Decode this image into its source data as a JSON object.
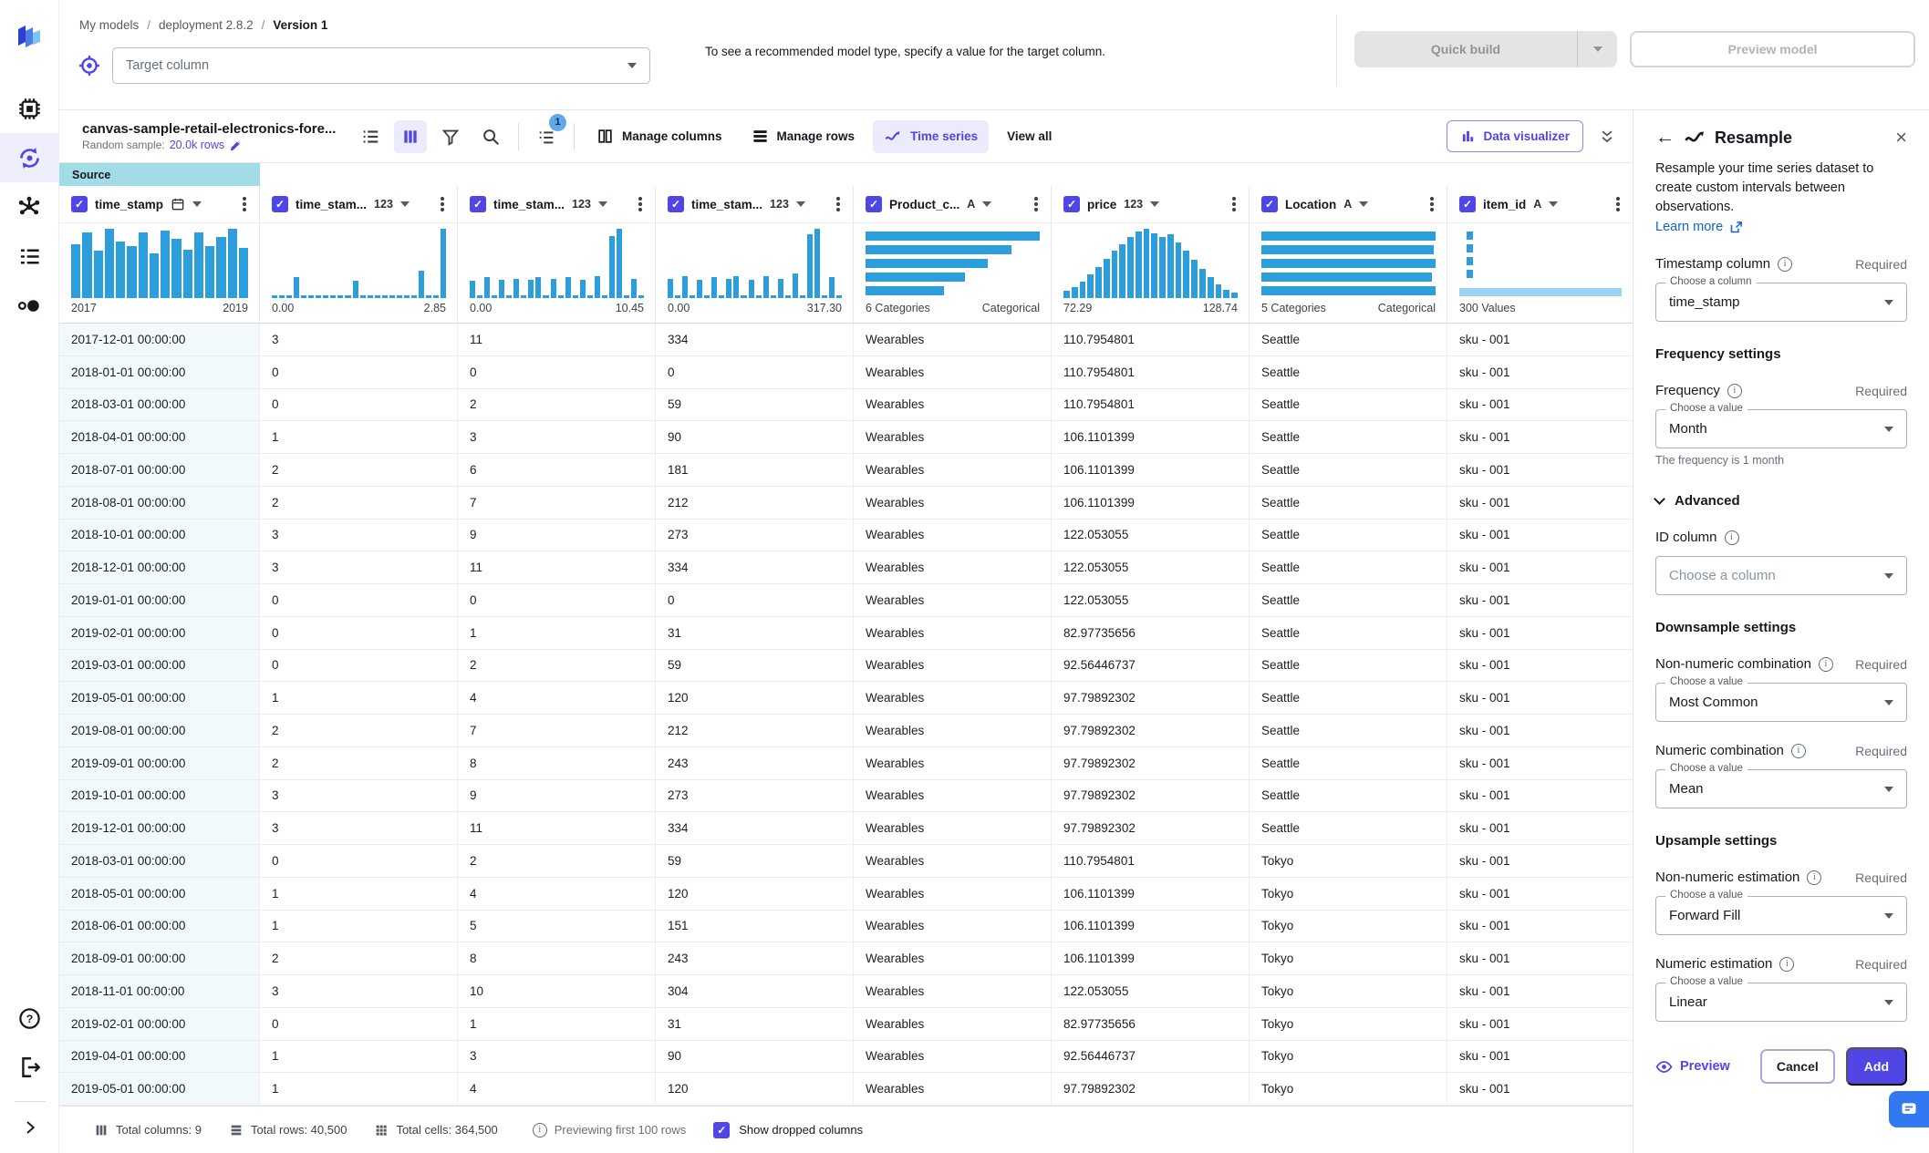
{
  "colors": {
    "accent": "#4F46E5",
    "accent_light": "#ECEBFB",
    "histogram_blue": "#2B9EDB",
    "histogram_light_blue": "#9BD4F2",
    "source_tab": "#A2DDE7",
    "link_blue": "#0F62D6"
  },
  "icons": {
    "sidebar": [
      "app-logo",
      "datasets-icon",
      "my-models-icon",
      "workflow-icon",
      "list-icon",
      "record-icon",
      "help-icon",
      "logout-icon",
      "expand-chevron-icon"
    ],
    "toolbar": [
      "list-view-icon",
      "column-view-icon",
      "filter-icon",
      "search-icon",
      "sort-list-icon",
      "manage-columns-icon",
      "manage-rows-icon",
      "time-series-icon",
      "bar-chart-icon",
      "collapse-double-chevron-icon"
    ],
    "other": [
      "target-icon",
      "calendar-icon",
      "info-icon",
      "eye-icon",
      "external-link-icon",
      "chat-icon",
      "pencil-icon"
    ]
  },
  "breadcrumb": {
    "items": [
      "My models",
      "deployment 2.8.2"
    ],
    "separator": "/",
    "current": "Version 1"
  },
  "target": {
    "placeholder": "Target column",
    "hint": "To see a recommended model type, specify a value for the target column."
  },
  "header_actions": {
    "quick_build": "Quick build",
    "preview_model": "Preview model"
  },
  "toolbar": {
    "dataset_name": "canvas-sample-retail-electronics-fore...",
    "sample_label": "Random sample:",
    "sample_value": "20.0k rows",
    "filter_badge": "1",
    "manage_columns": "Manage columns",
    "manage_rows": "Manage rows",
    "time_series": "Time series",
    "view_all": "View all",
    "data_visualizer": "Data visualizer"
  },
  "table": {
    "source_tab": "Source",
    "columns": [
      {
        "name": "time_stamp",
        "type": "date",
        "footer_left": "2017",
        "footer_right": "2019",
        "hist": {
          "kind": "vbar",
          "values": [
            78,
            95,
            68,
            100,
            82,
            75,
            95,
            65,
            98,
            85,
            70,
            95,
            75,
            88,
            100,
            72
          ]
        }
      },
      {
        "name": "time_stam...",
        "type": "123",
        "footer_left": "0.00",
        "footer_right": "2.85",
        "hist": {
          "kind": "vbar",
          "values": [
            4,
            4,
            4,
            30,
            4,
            4,
            4,
            4,
            4,
            4,
            4,
            25,
            4,
            4,
            4,
            4,
            4,
            4,
            4,
            4,
            40,
            4,
            4,
            100
          ]
        }
      },
      {
        "name": "time_stam...",
        "type": "123",
        "footer_left": "0.00",
        "footer_right": "10.45",
        "hist": {
          "kind": "vbar",
          "values": [
            25,
            4,
            30,
            4,
            26,
            4,
            28,
            4,
            26,
            30,
            4,
            28,
            4,
            30,
            4,
            26,
            4,
            32,
            4,
            90,
            100,
            4,
            28,
            4
          ]
        }
      },
      {
        "name": "time_stam...",
        "type": "123",
        "footer_left": "0.00",
        "footer_right": "317.30",
        "hist": {
          "kind": "vbar",
          "values": [
            28,
            4,
            32,
            4,
            26,
            4,
            30,
            4,
            28,
            32,
            4,
            26,
            4,
            32,
            4,
            28,
            4,
            35,
            4,
            92,
            100,
            4,
            30,
            4
          ]
        }
      },
      {
        "name": "Product_c...",
        "type": "A",
        "footer_left": "6 Categories",
        "footer_right": "Categorical",
        "hist": {
          "kind": "hbar",
          "values": [
            100,
            84,
            70,
            57,
            45
          ]
        }
      },
      {
        "name": "price",
        "type": "123",
        "footer_left": "72.29",
        "footer_right": "128.74",
        "hist": {
          "kind": "vbar",
          "values": [
            10,
            16,
            24,
            34,
            45,
            56,
            68,
            78,
            88,
            96,
            100,
            94,
            88,
            92,
            80,
            68,
            55,
            42,
            30,
            20,
            12,
            8
          ]
        }
      },
      {
        "name": "Location",
        "type": "A",
        "footer_left": "5 Categories",
        "footer_right": "Categorical",
        "hist": {
          "kind": "hbar",
          "values": [
            100,
            99,
            100,
            98,
            100
          ]
        }
      },
      {
        "name": "item_id",
        "type": "A",
        "footer_left": "300 Values",
        "footer_right": "",
        "hist": {
          "kind": "values",
          "dash_segments": 4
        }
      }
    ],
    "rows": [
      [
        "2017-12-01 00:00:00",
        "3",
        "11",
        "334",
        "Wearables",
        "110.7954801",
        "Seattle",
        "sku - 001"
      ],
      [
        "2018-01-01 00:00:00",
        "0",
        "0",
        "0",
        "Wearables",
        "110.7954801",
        "Seattle",
        "sku - 001"
      ],
      [
        "2018-03-01 00:00:00",
        "0",
        "2",
        "59",
        "Wearables",
        "110.7954801",
        "Seattle",
        "sku - 001"
      ],
      [
        "2018-04-01 00:00:00",
        "1",
        "3",
        "90",
        "Wearables",
        "106.1101399",
        "Seattle",
        "sku - 001"
      ],
      [
        "2018-07-01 00:00:00",
        "2",
        "6",
        "181",
        "Wearables",
        "106.1101399",
        "Seattle",
        "sku - 001"
      ],
      [
        "2018-08-01 00:00:00",
        "2",
        "7",
        "212",
        "Wearables",
        "106.1101399",
        "Seattle",
        "sku - 001"
      ],
      [
        "2018-10-01 00:00:00",
        "3",
        "9",
        "273",
        "Wearables",
        "122.053055",
        "Seattle",
        "sku - 001"
      ],
      [
        "2018-12-01 00:00:00",
        "3",
        "11",
        "334",
        "Wearables",
        "122.053055",
        "Seattle",
        "sku - 001"
      ],
      [
        "2019-01-01 00:00:00",
        "0",
        "0",
        "0",
        "Wearables",
        "122.053055",
        "Seattle",
        "sku - 001"
      ],
      [
        "2019-02-01 00:00:00",
        "0",
        "1",
        "31",
        "Wearables",
        "82.97735656",
        "Seattle",
        "sku - 001"
      ],
      [
        "2019-03-01 00:00:00",
        "0",
        "2",
        "59",
        "Wearables",
        "92.56446737",
        "Seattle",
        "sku - 001"
      ],
      [
        "2019-05-01 00:00:00",
        "1",
        "4",
        "120",
        "Wearables",
        "97.79892302",
        "Seattle",
        "sku - 001"
      ],
      [
        "2019-08-01 00:00:00",
        "2",
        "7",
        "212",
        "Wearables",
        "97.79892302",
        "Seattle",
        "sku - 001"
      ],
      [
        "2019-09-01 00:00:00",
        "2",
        "8",
        "243",
        "Wearables",
        "97.79892302",
        "Seattle",
        "sku - 001"
      ],
      [
        "2019-10-01 00:00:00",
        "3",
        "9",
        "273",
        "Wearables",
        "97.79892302",
        "Seattle",
        "sku - 001"
      ],
      [
        "2019-12-01 00:00:00",
        "3",
        "11",
        "334",
        "Wearables",
        "97.79892302",
        "Seattle",
        "sku - 001"
      ],
      [
        "2018-03-01 00:00:00",
        "0",
        "2",
        "59",
        "Wearables",
        "110.7954801",
        "Tokyo",
        "sku - 001"
      ],
      [
        "2018-05-01 00:00:00",
        "1",
        "4",
        "120",
        "Wearables",
        "106.1101399",
        "Tokyo",
        "sku - 001"
      ],
      [
        "2018-06-01 00:00:00",
        "1",
        "5",
        "151",
        "Wearables",
        "106.1101399",
        "Tokyo",
        "sku - 001"
      ],
      [
        "2018-09-01 00:00:00",
        "2",
        "8",
        "243",
        "Wearables",
        "106.1101399",
        "Tokyo",
        "sku - 001"
      ],
      [
        "2018-11-01 00:00:00",
        "3",
        "10",
        "304",
        "Wearables",
        "122.053055",
        "Tokyo",
        "sku - 001"
      ],
      [
        "2019-02-01 00:00:00",
        "0",
        "1",
        "31",
        "Wearables",
        "82.97735656",
        "Tokyo",
        "sku - 001"
      ],
      [
        "2019-04-01 00:00:00",
        "1",
        "3",
        "90",
        "Wearables",
        "92.56446737",
        "Tokyo",
        "sku - 001"
      ],
      [
        "2019-05-01 00:00:00",
        "1",
        "4",
        "120",
        "Wearables",
        "97.79892302",
        "Tokyo",
        "sku - 001"
      ]
    ]
  },
  "panel": {
    "title": "Resample",
    "description": "Resample your time series dataset to create custom intervals between observations.",
    "learn_more": "Learn more",
    "required": "Required",
    "fields": {
      "timestamp": {
        "label": "Timestamp column",
        "legend": "Choose a column",
        "value": "time_stamp"
      },
      "frequency_section": "Frequency settings",
      "frequency": {
        "label": "Frequency",
        "legend": "Choose a value",
        "value": "Month",
        "helper": "The frequency is 1 month"
      },
      "advanced": "Advanced",
      "id_column": {
        "label": "ID column",
        "placeholder": "Choose a column"
      },
      "downsample_section": "Downsample settings",
      "non_numeric_combination": {
        "label": "Non-numeric combination",
        "legend": "Choose a value",
        "value": "Most Common"
      },
      "numeric_combination": {
        "label": "Numeric combination",
        "legend": "Choose a value",
        "value": "Mean"
      },
      "upsample_section": "Upsample settings",
      "non_numeric_estimation": {
        "label": "Non-numeric estimation",
        "legend": "Choose a value",
        "value": "Forward Fill"
      },
      "numeric_estimation": {
        "label": "Numeric estimation",
        "legend": "Choose a value",
        "value": "Linear"
      }
    },
    "footer": {
      "preview": "Preview",
      "cancel": "Cancel",
      "add": "Add"
    }
  },
  "statusbar": {
    "total_columns": "Total columns: 9",
    "total_rows": "Total rows: 40,500",
    "total_cells": "Total cells: 364,500",
    "previewing": "Previewing first 100 rows",
    "show_dropped": "Show dropped columns"
  }
}
